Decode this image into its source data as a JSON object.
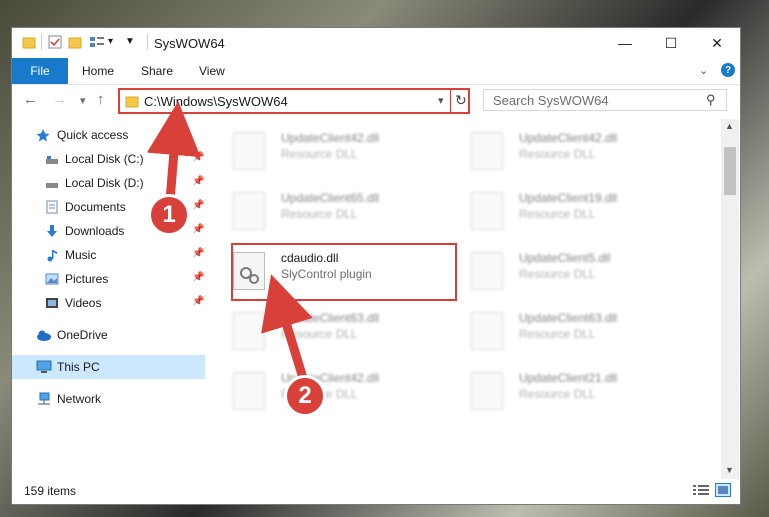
{
  "window": {
    "title": "SysWOW64",
    "icons": [
      "folder-icon",
      "properties-icon",
      "new-folder-icon",
      "view-icon",
      "dropdown-icon"
    ],
    "controls": {
      "minimize": "—",
      "maximize": "☐",
      "close": "✕"
    }
  },
  "ribbon": {
    "file": "File",
    "tabs": [
      "Home",
      "Share",
      "View"
    ],
    "help_icon": "?"
  },
  "nav": {
    "back": "←",
    "forward": "→",
    "recent": "▾",
    "up": "↑",
    "address": "C:\\Windows\\SysWOW64",
    "address_dropdown": "▾",
    "refresh": "↻",
    "search_placeholder": "Search SysWOW64",
    "search_icon": "⚲"
  },
  "sidebar": {
    "items": [
      {
        "label": "Quick access",
        "icon": "star-icon",
        "pinned": false
      },
      {
        "label": "Local Disk (C:)",
        "icon": "drive-icon",
        "pinned": true
      },
      {
        "label": "Local Disk (D:)",
        "icon": "drive-icon",
        "pinned": true
      },
      {
        "label": "Documents",
        "icon": "documents-icon",
        "pinned": true
      },
      {
        "label": "Downloads",
        "icon": "download-icon",
        "pinned": true
      },
      {
        "label": "Music",
        "icon": "music-icon",
        "pinned": true
      },
      {
        "label": "Pictures",
        "icon": "pictures-icon",
        "pinned": true
      },
      {
        "label": "Videos",
        "icon": "videos-icon",
        "pinned": true
      },
      {
        "label": "OneDrive",
        "icon": "cloud-icon",
        "pinned": false
      },
      {
        "label": "This PC",
        "icon": "computer-icon",
        "pinned": false,
        "selected": true
      },
      {
        "label": "Network",
        "icon": "network-icon",
        "pinned": false
      }
    ],
    "pin_glyph": "📌"
  },
  "files": {
    "left": [
      {
        "name": "UpdateClient42.dll",
        "desc": "Resource DLL",
        "blurred": true
      },
      {
        "name": "UpdateClient65.dll",
        "desc": "Resource DLL",
        "blurred": true
      },
      {
        "name": "cdaudio.dll",
        "desc": "SlyControl plugin",
        "blurred": false
      },
      {
        "name": "UpdateClient63.dll",
        "desc": "Resource DLL",
        "blurred": true
      },
      {
        "name": "UpdateClient42.dll",
        "desc": "Resource DLL",
        "blurred": true
      }
    ],
    "right": [
      {
        "name": "UpdateClient42.dll",
        "desc": "Resource DLL",
        "blurred": true
      },
      {
        "name": "UpdateClient19.dll",
        "desc": "Resource DLL",
        "blurred": true
      },
      {
        "name": "UpdateClient5.dll",
        "desc": "Resource DLL",
        "blurred": true
      },
      {
        "name": "UpdateClient63.dll",
        "desc": "Resource DLL",
        "blurred": true
      },
      {
        "name": "UpdateClient21.dll",
        "desc": "Resource DLL",
        "blurred": true
      }
    ]
  },
  "status": {
    "count": "159 items"
  },
  "annotations": {
    "step1": "1",
    "step2": "2",
    "color": "#d9403a"
  },
  "colors": {
    "accent": "#1979ca",
    "selected_bg": "#cce8ff"
  }
}
